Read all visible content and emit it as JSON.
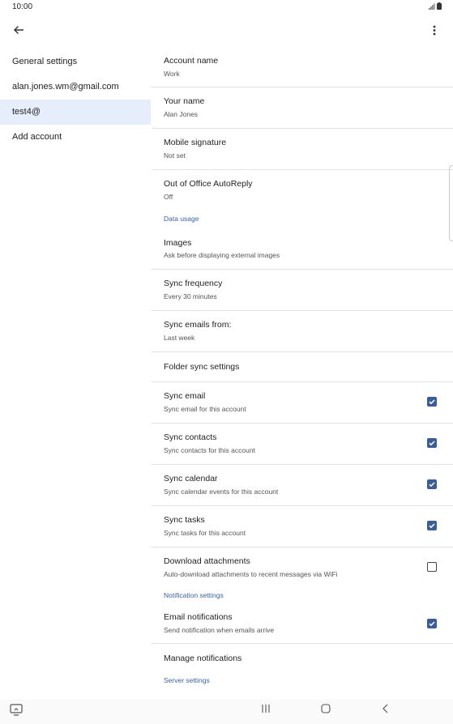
{
  "status": {
    "time": "10:00"
  },
  "sidebar": {
    "items": [
      {
        "label": "General settings"
      },
      {
        "label": "alan.jones.wm@gmail.com"
      },
      {
        "label": "test4@"
      },
      {
        "label": "Add account"
      }
    ]
  },
  "main": {
    "account_name": {
      "title": "Account name",
      "value": "Work"
    },
    "your_name": {
      "title": "Your name",
      "value": "Alan Jones"
    },
    "mobile_signature": {
      "title": "Mobile signature",
      "value": "Not set"
    },
    "out_of_office": {
      "title": "Out of Office AutoReply",
      "value": "Off"
    },
    "data_usage_header": "Data usage",
    "images": {
      "title": "Images",
      "value": "Ask before displaying external images"
    },
    "sync_frequency": {
      "title": "Sync frequency",
      "value": "Every 30 minutes"
    },
    "sync_emails_from": {
      "title": "Sync emails from:",
      "value": "Last week"
    },
    "folder_sync": {
      "title": "Folder sync settings"
    },
    "sync_email": {
      "title": "Sync email",
      "value": "Sync email for this account",
      "checked": true
    },
    "sync_contacts": {
      "title": "Sync contacts",
      "value": "Sync contacts for this account",
      "checked": true
    },
    "sync_calendar": {
      "title": "Sync calendar",
      "value": "Sync calendar events for this account",
      "checked": true
    },
    "sync_tasks": {
      "title": "Sync tasks",
      "value": "Sync tasks for this account",
      "checked": true
    },
    "download_attachments": {
      "title": "Download attachments",
      "value": "Auto-download attachments to recent messages via WiFi",
      "checked": false
    },
    "notification_header": "Notification settings",
    "email_notifications": {
      "title": "Email notifications",
      "value": "Send notification when emails arrive",
      "checked": true
    },
    "manage_notifications": {
      "title": "Manage notifications"
    },
    "server_header": "Server settings"
  },
  "icons": [
    "back-arrow-icon",
    "more-vert-icon",
    "signal-icon",
    "battery-icon",
    "screenshot-icon",
    "recents-icon",
    "home-icon",
    "nav-back-icon"
  ],
  "colors": {
    "accent": "#3b5c9a",
    "selected_bg": "#e7eefb",
    "section": "#3b62a6"
  }
}
